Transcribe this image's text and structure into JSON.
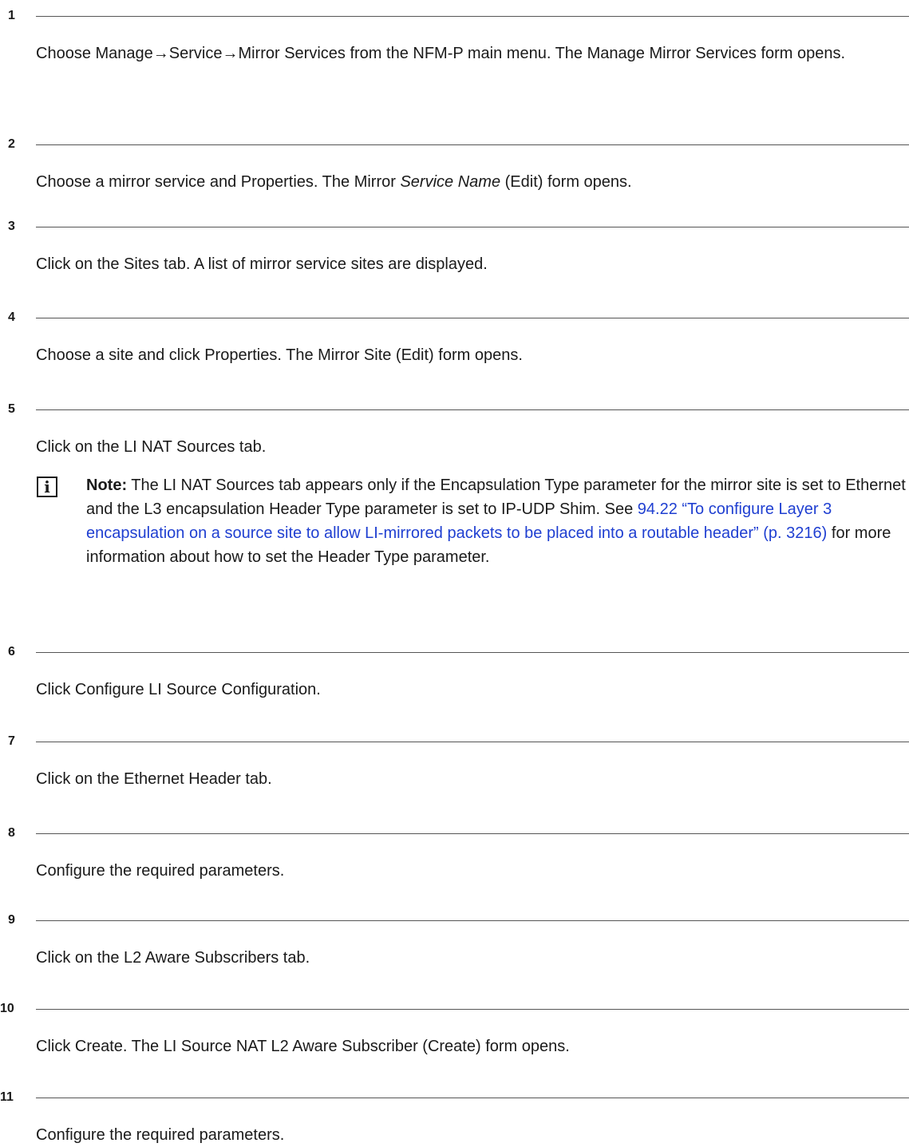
{
  "steps": [
    {
      "number": "1",
      "text": "Choose Manage→Service→Mirror Services from the NFM-P main menu. The Manage Mirror Services form opens."
    },
    {
      "number": "2",
      "text_before": "Choose a mirror service and Properties. The Mirror ",
      "text_italic": "Service Name",
      "text_after": " (Edit) form opens."
    },
    {
      "number": "3",
      "text": "Click on the Sites tab. A list of mirror service sites are displayed."
    },
    {
      "number": "4",
      "text": "Choose a site and click Properties. The Mirror Site (Edit) form opens."
    },
    {
      "number": "5",
      "text": "Click on the LI NAT Sources tab.",
      "note": {
        "icon": "info-icon",
        "icon_glyph": "i",
        "label": "Note:",
        "text_before": " The LI NAT Sources tab appears only if the Encapsulation Type parameter for the mirror site is set to Ethernet and the L3 encapsulation Header Type parameter is set to IP-UDP Shim. See ",
        "link_text": "94.22 “To configure Layer 3 encapsulation on a source site to allow LI-mirrored packets to be placed into a routable header” (p. 3216)",
        "text_after": " for more information about how to set the Header Type parameter."
      }
    },
    {
      "number": "6",
      "text": "Click Configure LI Source Configuration."
    },
    {
      "number": "7",
      "text": "Click on the Ethernet Header tab."
    },
    {
      "number": "8",
      "text": "Configure the required parameters."
    },
    {
      "number": "9",
      "text": "Click on the L2 Aware Subscribers tab."
    },
    {
      "number": "10",
      "text": "Click Create. The LI Source NAT L2 Aware Subscriber (Create) form opens."
    },
    {
      "number": "11",
      "text": "Configure the required parameters."
    }
  ],
  "colors": {
    "link": "#1f3fd1",
    "rule": "#555555",
    "text": "#1a1a1a"
  }
}
